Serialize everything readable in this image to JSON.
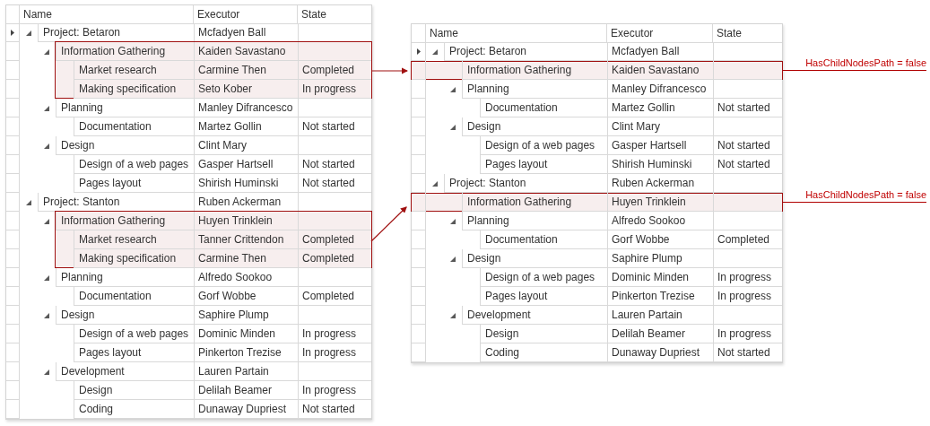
{
  "grids": [
    {
      "columns": [
        "Name",
        "Executor",
        "State"
      ],
      "rows": [
        {
          "name": "Project: Betaron",
          "executor": "Mcfadyen Ball",
          "expanded": true,
          "current": true,
          "children": [
            {
              "name": "Information Gathering",
              "executor": "Kaiden Savastano",
              "expanded": true,
              "highlighted": true,
              "children": [
                {
                  "name": "Market research",
                  "executor": "Carmine Then",
                  "state": "Completed"
                },
                {
                  "name": "Making specification",
                  "executor": "Seto Kober",
                  "state": "In progress"
                }
              ]
            },
            {
              "name": "Planning",
              "executor": "Manley Difrancesco",
              "expanded": true,
              "children": [
                {
                  "name": "Documentation",
                  "executor": "Martez Gollin",
                  "state": "Not started"
                }
              ]
            },
            {
              "name": "Design",
              "executor": "Clint Mary",
              "expanded": true,
              "children": [
                {
                  "name": "Design of a web pages",
                  "executor": "Gasper Hartsell",
                  "state": "Not started"
                },
                {
                  "name": "Pages layout",
                  "executor": "Shirish Huminski",
                  "state": "Not started"
                }
              ]
            }
          ]
        },
        {
          "name": "Project: Stanton",
          "executor": "Ruben Ackerman",
          "expanded": true,
          "current": false,
          "children": [
            {
              "name": "Information Gathering",
              "executor": "Huyen Trinklein",
              "expanded": true,
              "highlighted": true,
              "children": [
                {
                  "name": "Market research",
                  "executor": "Tanner Crittendon",
                  "state": "Completed"
                },
                {
                  "name": "Making specification",
                  "executor": "Carmine Then",
                  "state": "Completed"
                }
              ]
            },
            {
              "name": "Planning",
              "executor": "Alfredo Sookoo",
              "expanded": true,
              "children": [
                {
                  "name": "Documentation",
                  "executor": "Gorf Wobbe",
                  "state": "Completed"
                }
              ]
            },
            {
              "name": "Design",
              "executor": "Saphire Plump",
              "expanded": true,
              "children": [
                {
                  "name": "Design of a web pages",
                  "executor": "Dominic Minden",
                  "state": "In progress"
                },
                {
                  "name": "Pages layout",
                  "executor": "Pinkerton Trezise",
                  "state": "In progress"
                }
              ]
            },
            {
              "name": "Development",
              "executor": "Lauren Partain",
              "expanded": true,
              "children": [
                {
                  "name": "Design",
                  "executor": "Delilah Beamer",
                  "state": "In progress"
                },
                {
                  "name": "Coding",
                  "executor": "Dunaway Dupriest",
                  "state": "Not started"
                }
              ]
            }
          ]
        }
      ]
    },
    {
      "columns": [
        "Name",
        "Executor",
        "State"
      ],
      "rows": [
        {
          "name": "Project: Betaron",
          "executor": "Mcfadyen Ball",
          "expanded": true,
          "current": true,
          "children": [
            {
              "name": "Information Gathering",
              "executor": "Kaiden Savastano",
              "highlighted": true,
              "note": "HasChildNodesPath = false"
            },
            {
              "name": "Planning",
              "executor": "Manley Difrancesco",
              "expanded": true,
              "children": [
                {
                  "name": "Documentation",
                  "executor": "Martez Gollin",
                  "state": "Not started"
                }
              ]
            },
            {
              "name": "Design",
              "executor": "Clint Mary",
              "expanded": true,
              "children": [
                {
                  "name": "Design of a web pages",
                  "executor": "Gasper Hartsell",
                  "state": "Not started"
                },
                {
                  "name": "Pages layout",
                  "executor": "Shirish Huminski",
                  "state": "Not started"
                }
              ]
            }
          ]
        },
        {
          "name": "Project: Stanton",
          "executor": "Ruben Ackerman",
          "expanded": true,
          "current": false,
          "children": [
            {
              "name": "Information Gathering",
              "executor": "Huyen Trinklein",
              "highlighted": true,
              "note": "HasChildNodesPath = false"
            },
            {
              "name": "Planning",
              "executor": "Alfredo Sookoo",
              "expanded": true,
              "children": [
                {
                  "name": "Documentation",
                  "executor": "Gorf Wobbe",
                  "state": "Completed"
                }
              ]
            },
            {
              "name": "Design",
              "executor": "Saphire Plump",
              "expanded": true,
              "children": [
                {
                  "name": "Design of a web pages",
                  "executor": "Dominic Minden",
                  "state": "In progress"
                },
                {
                  "name": "Pages layout",
                  "executor": "Pinkerton Trezise",
                  "state": "In progress"
                }
              ]
            },
            {
              "name": "Development",
              "executor": "Lauren Partain",
              "expanded": true,
              "children": [
                {
                  "name": "Design",
                  "executor": "Delilah Beamer",
                  "state": "In progress"
                },
                {
                  "name": "Coding",
                  "executor": "Dunaway Dupriest",
                  "state": "Not started"
                }
              ]
            }
          ]
        }
      ]
    }
  ]
}
